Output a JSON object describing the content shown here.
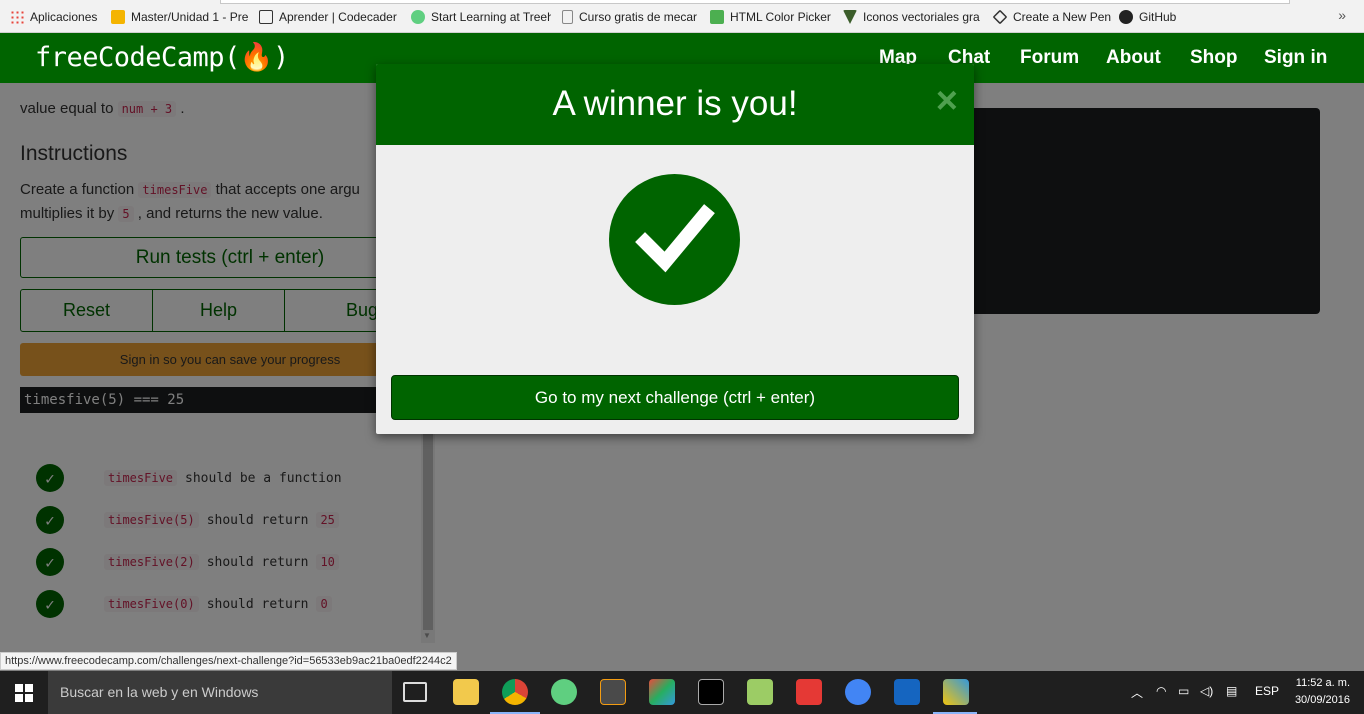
{
  "bookmarks": [
    {
      "label": "Aplicaciones",
      "icon": "apps-grid-icon",
      "color": "#e8453c"
    },
    {
      "label": "Master/Unidad 1 - Pre",
      "icon": "slides-icon",
      "color": "#f4b400"
    },
    {
      "label": "Aprender | Codecader",
      "icon": "codecademy-icon",
      "color": "#333333"
    },
    {
      "label": "Start Learning at Treeh",
      "icon": "treehouse-icon",
      "color": "#5fcf80"
    },
    {
      "label": "Curso gratis de mecar",
      "icon": "page-icon",
      "color": "#888888"
    },
    {
      "label": "HTML Color Picker",
      "icon": "color-picker-icon",
      "color": "#4caf50"
    },
    {
      "label": "Iconos vectoriales gra",
      "icon": "vector-icon",
      "color": "#3b5d2a"
    },
    {
      "label": "Create a New Pen",
      "icon": "codepen-icon",
      "color": "#333333"
    },
    {
      "label": "GitHub",
      "icon": "github-icon",
      "color": "#222222"
    }
  ],
  "bookmarks_more": "»",
  "nav": {
    "logo": "freeCodeCamp(🔥)",
    "links": [
      "Map",
      "Chat",
      "Forum",
      "About",
      "Shop",
      "Sign in"
    ]
  },
  "lesson": {
    "cut_text_prefix": "value equal to",
    "cut_code": "num + 3",
    "cut_text_suffix": ".",
    "instructions_heading": "Instructions",
    "instr_line1_a": "Create a function",
    "instr_code1": "timesFive",
    "instr_line1_b": "that accepts one argu",
    "instr_line2_a": "multiplies it by",
    "instr_code2": "5",
    "instr_line2_b": ", and returns the new value.",
    "run_button": "Run tests (ctrl + enter)",
    "reset_button": "Reset",
    "help_button": "Help",
    "bug_button": "Bug",
    "signin_notice": "Sign in so you can save your progress",
    "output": "timesfive(5) === 25"
  },
  "tests": [
    {
      "code1": "timesFive",
      "text": "should be a function",
      "code2": ""
    },
    {
      "code1": "timesFive(5)",
      "text": "should return",
      "code2": "25"
    },
    {
      "code1": "timesFive(2)",
      "text": "should return",
      "code2": "10"
    },
    {
      "code1": "timesFive(0)",
      "text": "should return",
      "code2": "0"
    }
  ],
  "modal": {
    "title": "A winner is you!",
    "close": "×",
    "next_button": "Go to my next challenge (ctrl + enter)"
  },
  "status_url": "https://www.freecodecamp.com/challenges/next-challenge?id=56533eb9ac21ba0edf2244c2",
  "taskbar": {
    "search_placeholder": "Buscar en la web y en Windows",
    "lang": "ESP",
    "time": "11:52 a. m.",
    "date": "30/09/2016"
  },
  "colors": {
    "brand_green": "#006400",
    "warning": "#eea236"
  }
}
